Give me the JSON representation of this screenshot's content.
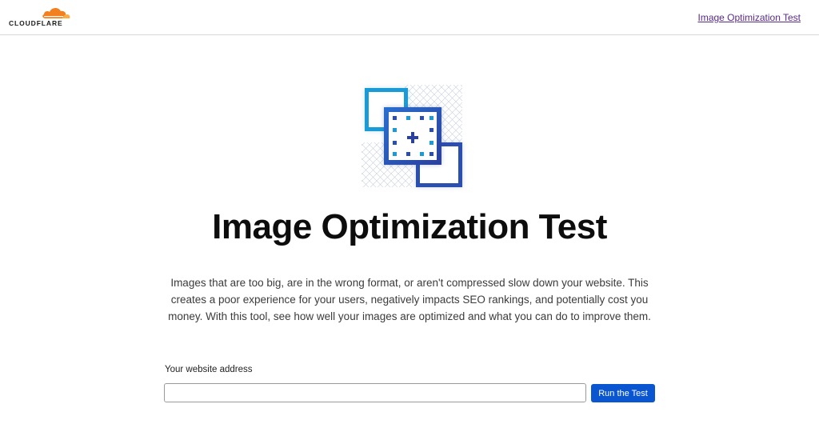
{
  "header": {
    "logo_text": "CLOUDFLARE",
    "nav_link": "Image Optimization Test"
  },
  "main": {
    "title": "Image Optimization Test",
    "description": "Images that are too big, are in the wrong format, or aren't compressed slow down your website. This creates a poor experience for your users, negatively impacts SEO rankings, and potentially cost you money. With this tool, see how well your images are optimized and what you can do to improve them.",
    "form": {
      "label": "Your website address",
      "input_value": "",
      "input_placeholder": "",
      "button_label": "Run the Test"
    }
  },
  "icons": {
    "logo": "cloudflare-cloud-icon",
    "hero": "image-optimization-icon"
  },
  "colors": {
    "brand_orange": "#f38020",
    "brand_orange_light": "#faae40",
    "button_blue": "#0a55d0",
    "link_purple": "#5a2a8a",
    "graphic_cyan": "#1a9ad6",
    "graphic_blue": "#2a4fb0"
  }
}
